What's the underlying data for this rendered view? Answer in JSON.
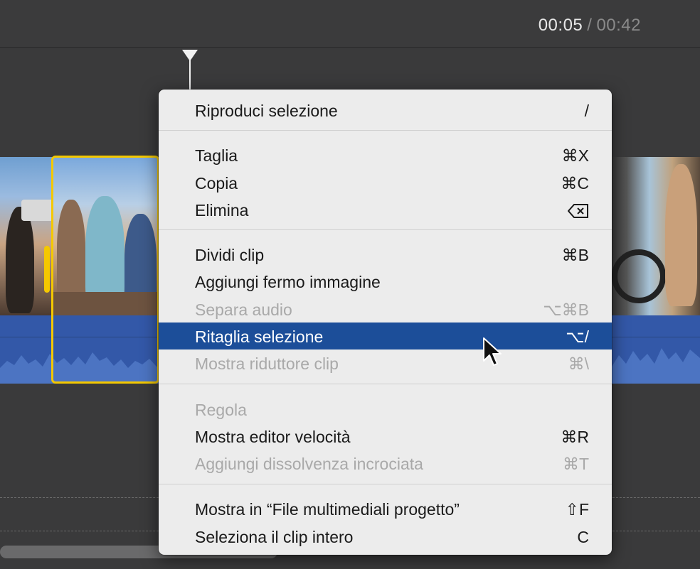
{
  "header": {
    "current_time": "00:05",
    "separator": "/",
    "total_time": "00:42"
  },
  "menu": {
    "items": [
      {
        "label": "Riproduci selezione",
        "shortcut": "/",
        "enabled": true
      },
      {
        "label": "Taglia",
        "shortcut": "⌘X",
        "enabled": true
      },
      {
        "label": "Copia",
        "shortcut": "⌘C",
        "enabled": true
      },
      {
        "label": "Elimina",
        "shortcut": "",
        "enabled": true
      },
      {
        "label": "Dividi clip",
        "shortcut": "⌘B",
        "enabled": true
      },
      {
        "label": "Aggiungi fermo immagine",
        "shortcut": "",
        "enabled": true
      },
      {
        "label": "Separa audio",
        "shortcut": "⌥⌘B",
        "enabled": false
      },
      {
        "label": "Ritaglia selezione",
        "shortcut": "⌥/",
        "enabled": true,
        "highlighted": true
      },
      {
        "label": "Mostra riduttore clip",
        "shortcut": "⌘\\",
        "enabled": false
      },
      {
        "label": "Regola",
        "shortcut": "",
        "enabled": false
      },
      {
        "label": "Mostra editor velocità",
        "shortcut": "⌘R",
        "enabled": true
      },
      {
        "label": "Aggiungi dissolvenza incrociata",
        "shortcut": "⌘T",
        "enabled": false
      },
      {
        "label": "Mostra in “File multimediali progetto”",
        "shortcut": "⇧F",
        "enabled": true
      },
      {
        "label": "Seleziona il clip intero",
        "shortcut": "C",
        "enabled": true
      }
    ],
    "highlight_color": "#1c4e99"
  },
  "colors": {
    "selection": "#f4c800",
    "audio": "#3358a8",
    "background": "#3a3a3b"
  }
}
